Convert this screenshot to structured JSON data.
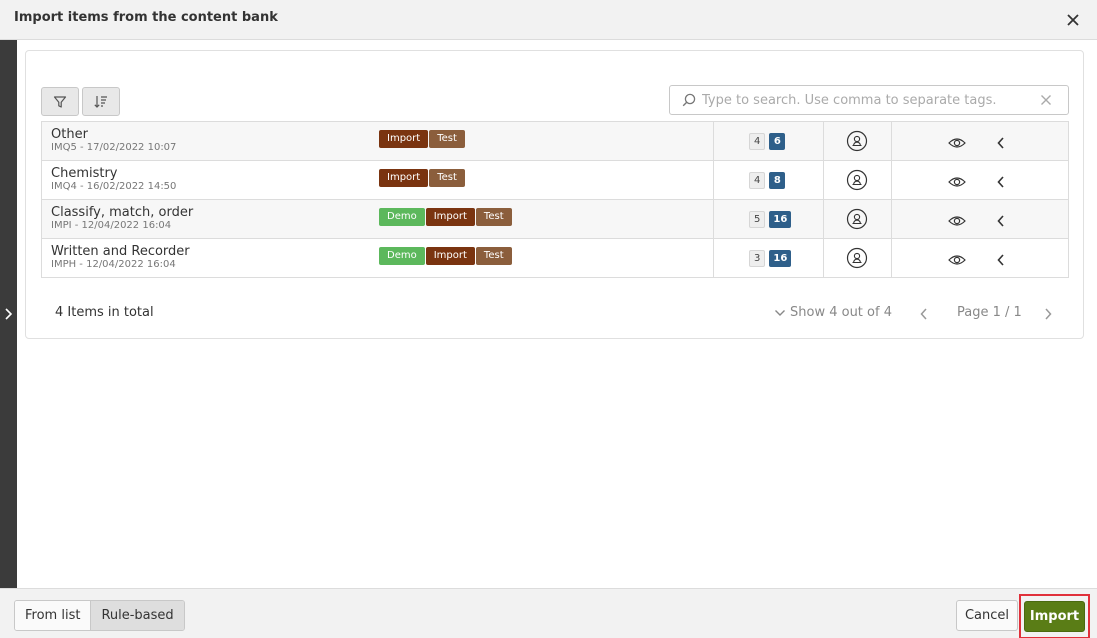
{
  "dialog": {
    "title": "Import items from the content bank"
  },
  "search": {
    "placeholder": "Type to search. Use comma to separate tags."
  },
  "items": [
    {
      "name": "Other",
      "meta": "IMQ5 - 17/02/2022 10:07",
      "tags": [
        "Import",
        "Test"
      ],
      "count_a": "4",
      "count_b": "6"
    },
    {
      "name": "Chemistry",
      "meta": "IMQ4 - 16/02/2022 14:50",
      "tags": [
        "Import",
        "Test"
      ],
      "count_a": "4",
      "count_b": "8"
    },
    {
      "name": "Classify, match, order",
      "meta": "IMPI - 12/04/2022 16:04",
      "tags": [
        "Demo",
        "Import",
        "Test"
      ],
      "count_a": "5",
      "count_b": "16"
    },
    {
      "name": "Written and Recorder",
      "meta": "IMPH - 12/04/2022 16:04",
      "tags": [
        "Demo",
        "Import",
        "Test"
      ],
      "count_a": "3",
      "count_b": "16"
    }
  ],
  "summary": {
    "total": "4 Items in total",
    "show": "Show 4 out of 4",
    "page": "Page 1 / 1"
  },
  "footer": {
    "from_list": "From list",
    "rule_based": "Rule-based",
    "cancel": "Cancel",
    "import": "Import"
  },
  "colors": {
    "tag_demo": "#5cb85c",
    "tag_import": "#7a3410",
    "tag_test": "#8b5e3c",
    "count_dark": "#2e5f8a",
    "import_button": "#5a7d16",
    "highlight": "#e0303a"
  }
}
